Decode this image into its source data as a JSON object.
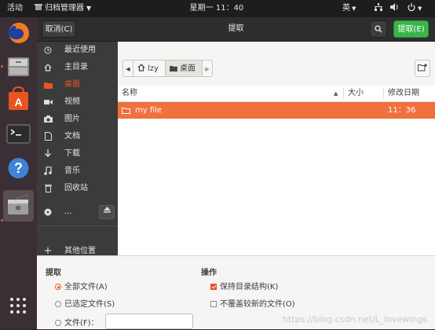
{
  "topbar": {
    "activities": "活动",
    "app_menu": "归档管理器",
    "clock": "星期一 11：40",
    "input_method": "英"
  },
  "dock": {
    "items": [
      {
        "name": "firefox"
      },
      {
        "name": "files"
      },
      {
        "name": "software"
      },
      {
        "name": "terminal"
      },
      {
        "name": "help"
      },
      {
        "name": "archive-manager"
      }
    ]
  },
  "headerbar": {
    "cancel": "取消(C)",
    "title": "提取",
    "extract": "提取(E)"
  },
  "sidebar": {
    "items": [
      {
        "label": "最近使用",
        "icon": "clock-icon"
      },
      {
        "label": "主目录",
        "icon": "home-icon"
      },
      {
        "label": "桌面",
        "icon": "folder-icon"
      },
      {
        "label": "视频",
        "icon": "video-icon"
      },
      {
        "label": "图片",
        "icon": "camera-icon"
      },
      {
        "label": "文档",
        "icon": "document-icon"
      },
      {
        "label": "下载",
        "icon": "download-icon"
      },
      {
        "label": "音乐",
        "icon": "music-icon"
      },
      {
        "label": "回收站",
        "icon": "trash-icon"
      },
      {
        "label": "...",
        "icon": "disc-icon"
      },
      {
        "label": "其他位置",
        "icon": "plus-icon"
      }
    ],
    "active": "桌面"
  },
  "pathbar": {
    "home": "lzy",
    "current": "桌面"
  },
  "filelist": {
    "columns": {
      "name": "名称",
      "size": "大小",
      "modified": "修改日期"
    },
    "rows": [
      {
        "name": "my file",
        "size": "",
        "modified": "11：36",
        "selected": true
      }
    ]
  },
  "options": {
    "extract_heading": "提取",
    "all_files": "全部文件(A)",
    "selected_files": "已选定文件(S)",
    "files_label": "文件(F)：",
    "files_value": "",
    "actions_heading": "操作",
    "keep_structure": "保持目录结构(K)",
    "keep_structure_checked": true,
    "no_overwrite": "不覆盖较新的文件(O)",
    "no_overwrite_checked": false,
    "selected_radio": "all"
  },
  "watermark": "https://blog.csdn.net/L_lovewings",
  "colors": {
    "accent": "#e95420",
    "extract_button": "#3bb54a",
    "selected_row": "#f0703e"
  }
}
